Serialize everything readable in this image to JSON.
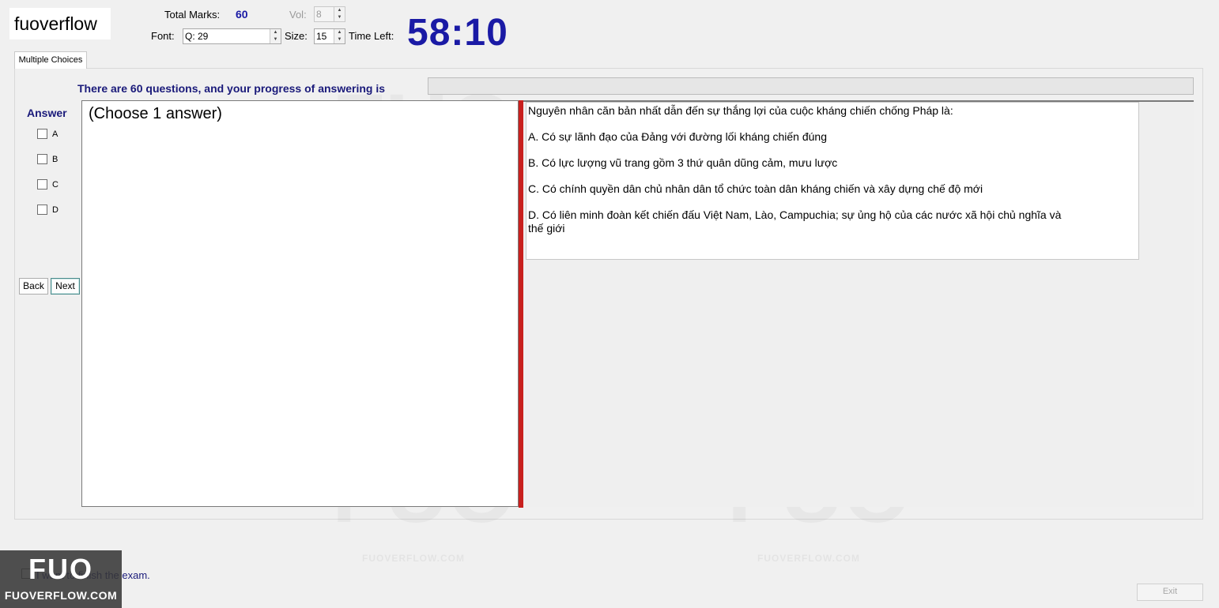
{
  "app": {
    "logo_text": "fuoverflow"
  },
  "header": {
    "total_marks_label": "Total Marks:",
    "total_marks_value": "60",
    "vol_label": "Vol:",
    "vol_value": "8",
    "font_label": "Font:",
    "font_value": "Q: 29",
    "size_label": "Size:",
    "size_value": "15",
    "time_left_label": "Time Left:",
    "time_left_value": "58:10"
  },
  "tabs": [
    {
      "label": "Multiple Choices"
    }
  ],
  "progress": {
    "text": "There are 60 questions, and your progress of answering is",
    "fraction": 0
  },
  "answer": {
    "title": "Answer",
    "options": [
      "A",
      "B",
      "C",
      "D"
    ]
  },
  "nav": {
    "back_label": "Back",
    "next_label": "Next"
  },
  "left_pane": {
    "instruction": "(Choose 1 answer)"
  },
  "question": {
    "stem": "Nguyên nhân căn bản nhất dẫn đến sự thắng lợi của cuộc kháng chiến chống Pháp là:",
    "choice_a": "A.  Có sự lãnh đạo của Đảng với đường lối kháng chiến đúng",
    "choice_b": "B.  Có lực lượng vũ trang gồm 3 thứ quân dũng cảm, mưu lược",
    "choice_c": "C.  Có chính quyền dân chủ nhân dân tổ chức toàn dân kháng chiến và xây dựng chế độ mới",
    "choice_d_line1": "D.  Có liên minh đoàn kết chiến đấu Việt Nam, Lào, Campuchia; sự ủng hộ của các nước xã hội chủ nghĩa và",
    "choice_d_line2": "thế giới"
  },
  "footer": {
    "finish_text": "I want to finish the exam.",
    "exit_label": "Exit"
  },
  "watermark": {
    "big_text": "FUO",
    "small_text": "FUOVERFLOW.COM"
  },
  "brand": {
    "mark": "FUO",
    "text": "FUOVERFLOW.COM"
  },
  "colors": {
    "accent_blue": "#1a1aa5",
    "label_navy": "#1a1a7a",
    "splitter_red": "#c8201e"
  }
}
